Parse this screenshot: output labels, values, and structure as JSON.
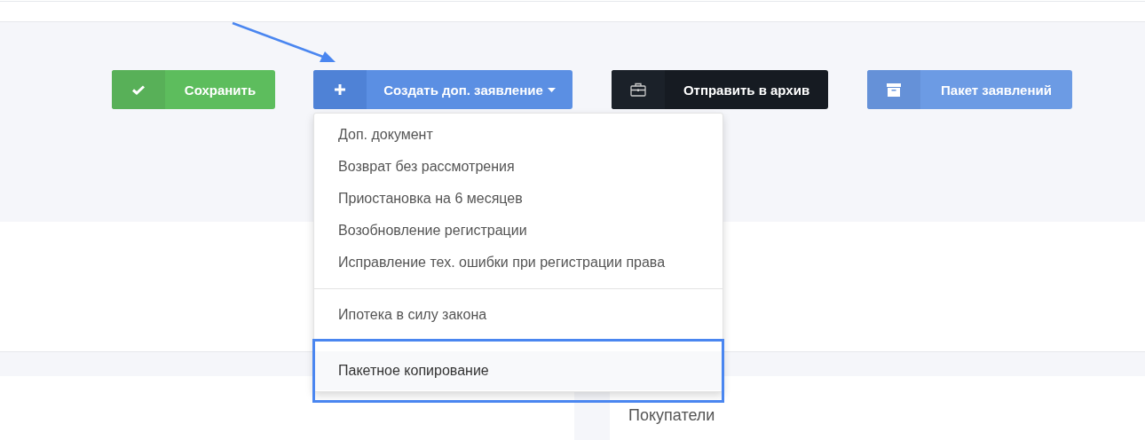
{
  "toolbar": {
    "buttons": [
      {
        "kind": "save",
        "label": "Сохранить",
        "dropdown": false
      },
      {
        "kind": "create",
        "label": "Создать доп. заявление",
        "dropdown": true
      },
      {
        "kind": "archive",
        "label": "Отправить в архив",
        "dropdown": false
      },
      {
        "kind": "packet",
        "label": "Пакет заявлений",
        "dropdown": false
      }
    ]
  },
  "menu": {
    "groups": [
      [
        {
          "label": "Доп. документ",
          "selected": false
        },
        {
          "label": "Возврат без рассмотрения",
          "selected": false
        },
        {
          "label": "Приостановка на 6 месяцев",
          "selected": false
        },
        {
          "label": "Возобновление регистрации",
          "selected": false
        },
        {
          "label": "Исправление тех. ошибки при регистрации права",
          "selected": false
        }
      ],
      [
        {
          "label": "Ипотека в силу закона",
          "selected": false
        }
      ],
      [
        {
          "label": "Пакетное копирование",
          "selected": true
        }
      ]
    ]
  },
  "section": {
    "heading": "Покупатели"
  }
}
